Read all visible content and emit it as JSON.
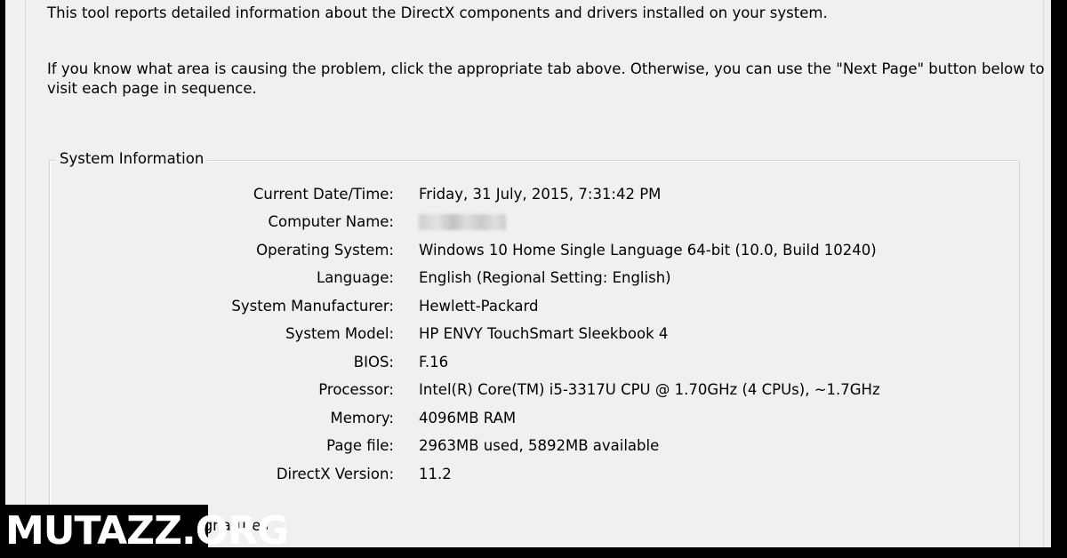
{
  "intro": {
    "line1": "This tool reports detailed information about the DirectX components and drivers installed on your system.",
    "line2": "If you know what area is causing the problem, click the appropriate tab above.  Otherwise, you can use the \"Next Page\" button below to",
    "line3": "visit each page in sequence."
  },
  "system_information": {
    "title": "System Information",
    "rows": [
      {
        "label": "Current Date/Time:",
        "value": "Friday, 31 July, 2015, 7:31:42 PM"
      },
      {
        "label": "Computer Name:",
        "value": "blurred"
      },
      {
        "label": "Operating System:",
        "value": "Windows 10 Home Single Language 64-bit (10.0, Build 10240)"
      },
      {
        "label": "Language:",
        "value": "English (Regional Setting: English)"
      },
      {
        "label": "System Manufacturer:",
        "value": "Hewlett-Packard"
      },
      {
        "label": "System Model:",
        "value": "HP ENVY TouchSmart Sleekbook 4"
      },
      {
        "label": "BIOS:",
        "value": "F.16"
      },
      {
        "label": "Processor:",
        "value": "Intel(R) Core(TM) i5-3317U CPU @ 1.70GHz (4 CPUs), ~1.7GHz"
      },
      {
        "label": "Memory:",
        "value": "4096MB RAM"
      },
      {
        "label": "Page file:",
        "value": "2963MB used, 5892MB available"
      },
      {
        "label": "DirectX Version:",
        "value": "11.2"
      }
    ]
  },
  "signatures": {
    "label": "digital signatures"
  },
  "watermark": {
    "text": "MUTAZZ.ORG"
  }
}
